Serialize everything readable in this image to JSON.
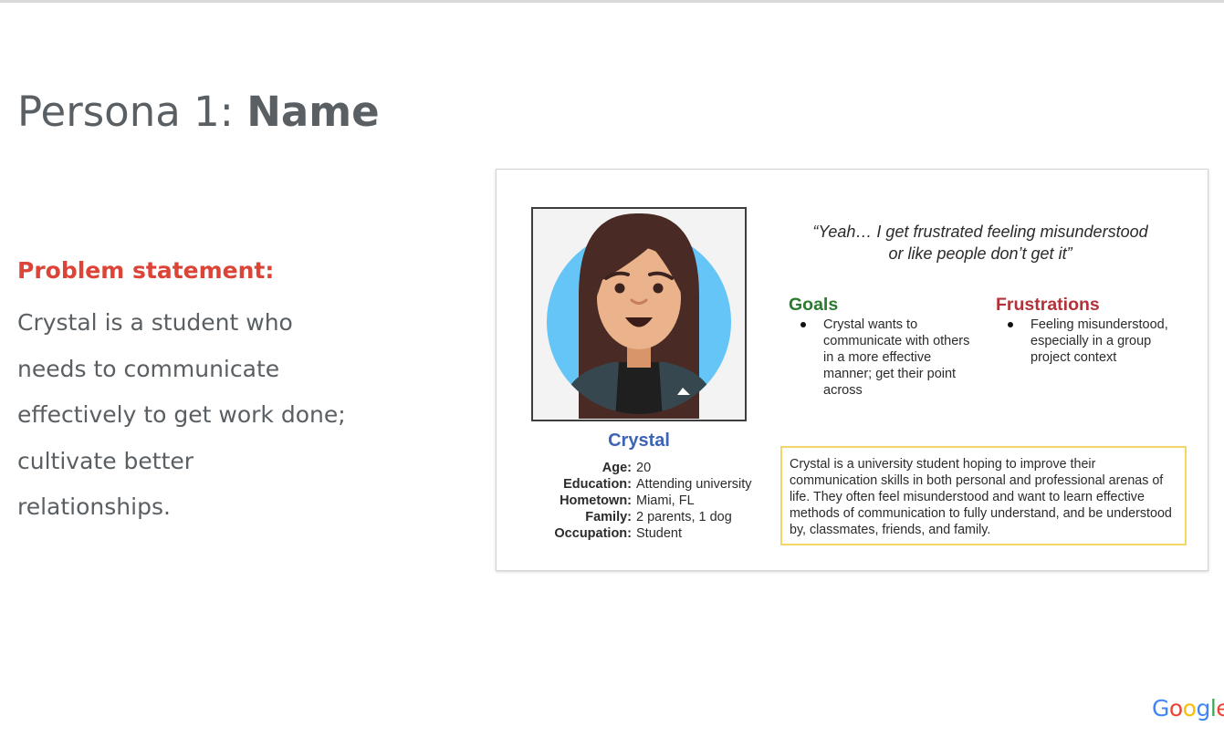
{
  "slide": {
    "title_prefix": "Persona 1: ",
    "title_bold": "Name",
    "problem_heading": "Problem statement:",
    "problem_text": "Crystal is a student who needs to communicate effectively to get work done; cultivate better relationships."
  },
  "persona": {
    "name": "Crystal",
    "quote_line1": "“Yeah… I get frustrated feeling misunderstood",
    "quote_line2": "or like people don’t get it”",
    "details": [
      {
        "label": "Age:",
        "value": "20"
      },
      {
        "label": "Education:",
        "value": "Attending university"
      },
      {
        "label": "Hometown:",
        "value": "Miami, FL"
      },
      {
        "label": "Family:",
        "value": "2 parents, 1 dog"
      },
      {
        "label": "Occupation:",
        "value": "Student"
      }
    ],
    "goals_title": "Goals",
    "goals": [
      "Crystal wants to communicate with others in a more effective manner; get their point across"
    ],
    "frustrations_title": "Frustrations",
    "frustrations": [
      "Feeling misunderstood, especially in a group project context"
    ],
    "bio": "Crystal is a university student hoping to improve their communication skills in both personal and professional arenas of life. They often feel misunderstood and want to learn effective methods of communication to fully understand, and be understood by, classmates, friends, and family."
  },
  "brand": {
    "logo_letters": [
      "G",
      "o",
      "o",
      "g",
      "l",
      "e"
    ],
    "logo_colors": [
      "#4285f4",
      "#ea4335",
      "#fbbc05",
      "#4285f4",
      "#34a853",
      "#ea4335"
    ]
  },
  "icons": {
    "persona_avatar": "avatar-illustration-icon"
  }
}
